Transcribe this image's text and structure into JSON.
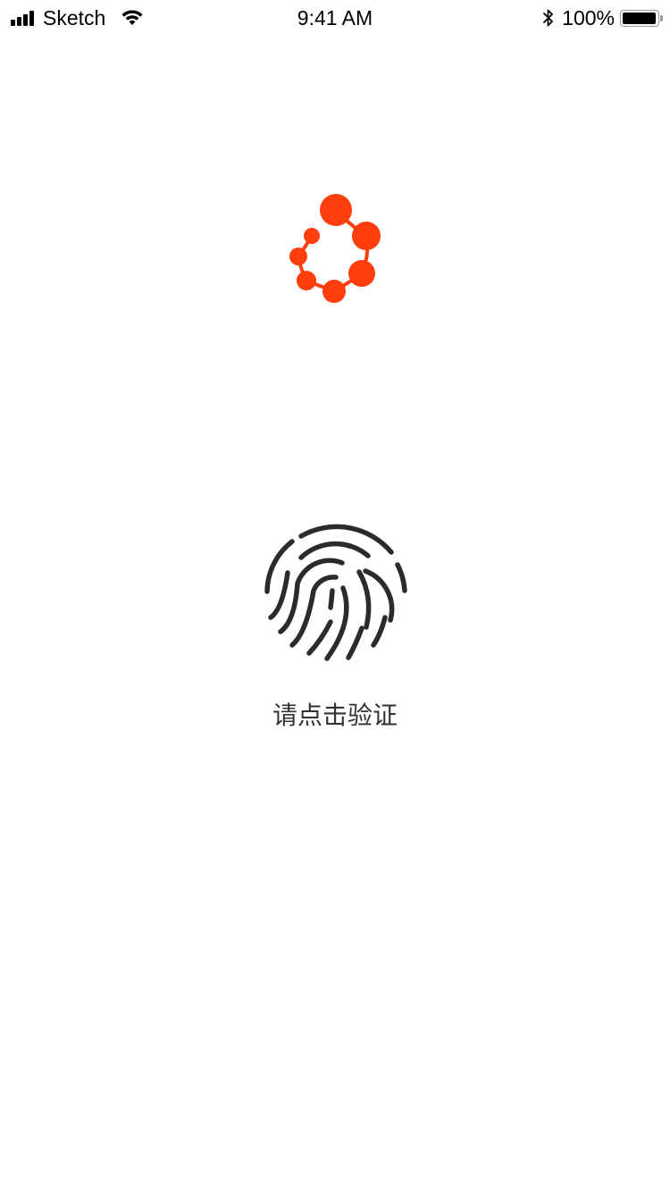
{
  "status_bar": {
    "carrier": "Sketch",
    "time": "9:41 AM",
    "battery_percent": "100%",
    "battery_level": 1.0,
    "signal_bars": 4,
    "icons": [
      "signal-icon",
      "wifi-icon",
      "bluetooth-icon",
      "battery-icon"
    ]
  },
  "logo": {
    "icon": "molecule-logo-icon",
    "color": "#FF3D0D"
  },
  "verify": {
    "icon": "fingerprint-icon",
    "icon_color": "#2B2B2B",
    "label": "请点击验证"
  }
}
